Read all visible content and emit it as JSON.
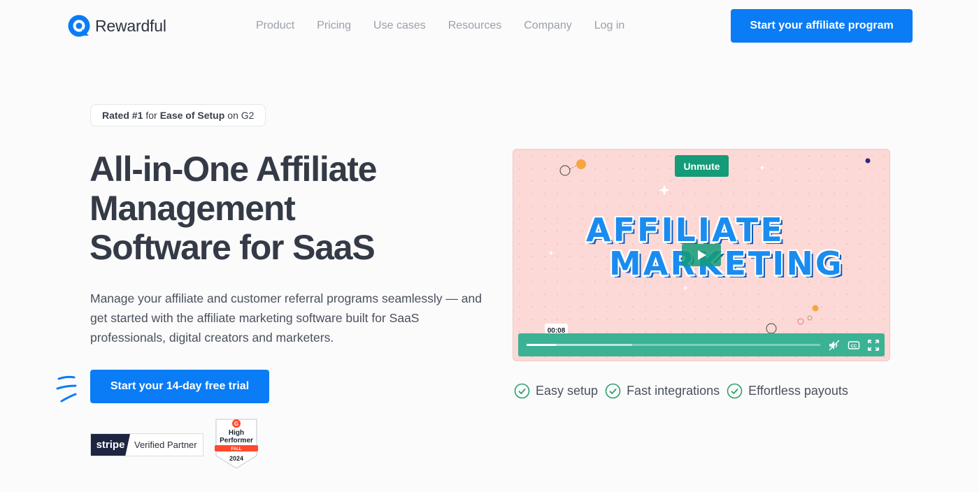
{
  "brand": {
    "name": "Rewardful",
    "color": "#0a7cf5"
  },
  "nav": {
    "items": [
      "Product",
      "Pricing",
      "Use cases",
      "Resources",
      "Company",
      "Log in"
    ],
    "cta": "Start your affiliate program"
  },
  "hero": {
    "badge": {
      "prefix": "Rated #1",
      "mid": " for ",
      "bold": "Ease of Setup",
      "suffix": " on G2"
    },
    "title_lines": [
      "All-in-One Affiliate",
      "Management",
      "Software for SaaS"
    ],
    "subtitle": "Manage your affiliate and customer referral programs seamlessly — and get started with the affiliate marketing software built for SaaS professionals, digital creators and marketers.",
    "trial_button": "Start your 14-day free trial",
    "stripe_badge": {
      "logo": "stripe",
      "label": "Verified Partner"
    },
    "g2_badge": {
      "line1": "High",
      "line2": "Performer",
      "season": "FALL",
      "year": "2024"
    }
  },
  "video": {
    "unmute_label": "Unmute",
    "headline_line1": "AFFILIATE",
    "headline_line2": "MARKETING",
    "time": "00:08",
    "progress": 0.1,
    "buffered": 0.36,
    "icons": [
      "play-icon",
      "mute-icon",
      "captions-icon",
      "fullscreen-icon"
    ]
  },
  "features": [
    "Easy setup",
    "Fast integrations",
    "Effortless payouts"
  ],
  "colors": {
    "accent": "#0a7cf5",
    "video_bg": "#fcd9d6",
    "video_controls": "#3bb294",
    "check": "#2da06b"
  }
}
